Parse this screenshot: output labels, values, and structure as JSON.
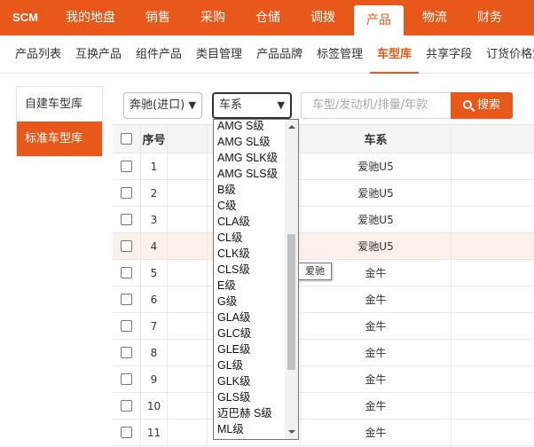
{
  "topnav": {
    "brand": "SCM",
    "items": [
      "我的地盘",
      "销售",
      "采购",
      "仓储",
      "调拨",
      "产品",
      "物流",
      "财务"
    ],
    "active_index": 5
  },
  "subnav": {
    "items": [
      "产品列表",
      "互换产品",
      "组件产品",
      "类目管理",
      "产品品牌",
      "标签管理",
      "车型库",
      "共享字段",
      "订货价格策略"
    ],
    "active_index": 6
  },
  "side": {
    "items": [
      "自建车型库",
      "标准车型库"
    ],
    "active_index": 1
  },
  "filters": {
    "brand_select": "奔驰(进口)",
    "series_select": "车系",
    "search_placeholder": "车型/发动机/排量/年款",
    "search_button": "搜索"
  },
  "table": {
    "headers": {
      "seq": "序号",
      "series": "车系"
    },
    "rows": [
      {
        "seq": "1",
        "series": "爱驰U5"
      },
      {
        "seq": "2",
        "series": "爱驰U5"
      },
      {
        "seq": "3",
        "series": "爱驰U5"
      },
      {
        "seq": "4",
        "series": "爱驰U5"
      },
      {
        "seq": "5",
        "series": "金牛"
      },
      {
        "seq": "6",
        "series": "金牛"
      },
      {
        "seq": "7",
        "series": "金牛"
      },
      {
        "seq": "8",
        "series": "金牛"
      },
      {
        "seq": "9",
        "series": "金牛"
      },
      {
        "seq": "10",
        "series": "金牛"
      },
      {
        "seq": "11",
        "series": "金牛"
      }
    ],
    "hover_row_index": 3
  },
  "tooltip": "爱驰",
  "dropdown": {
    "options": [
      "AMG S级",
      "AMG SL级",
      "AMG SLK级",
      "AMG SLS级",
      "B级",
      "C级",
      "CLA级",
      "CL级",
      "CLK级",
      "CLS级",
      "E级",
      "G级",
      "GLA级",
      "GLC级",
      "GLE级",
      "GL级",
      "GLK级",
      "GLS级",
      "迈巴赫 S级",
      "ML级"
    ]
  },
  "colors": {
    "accent": "#e8581a",
    "hover_row": "#fcf0ea"
  }
}
